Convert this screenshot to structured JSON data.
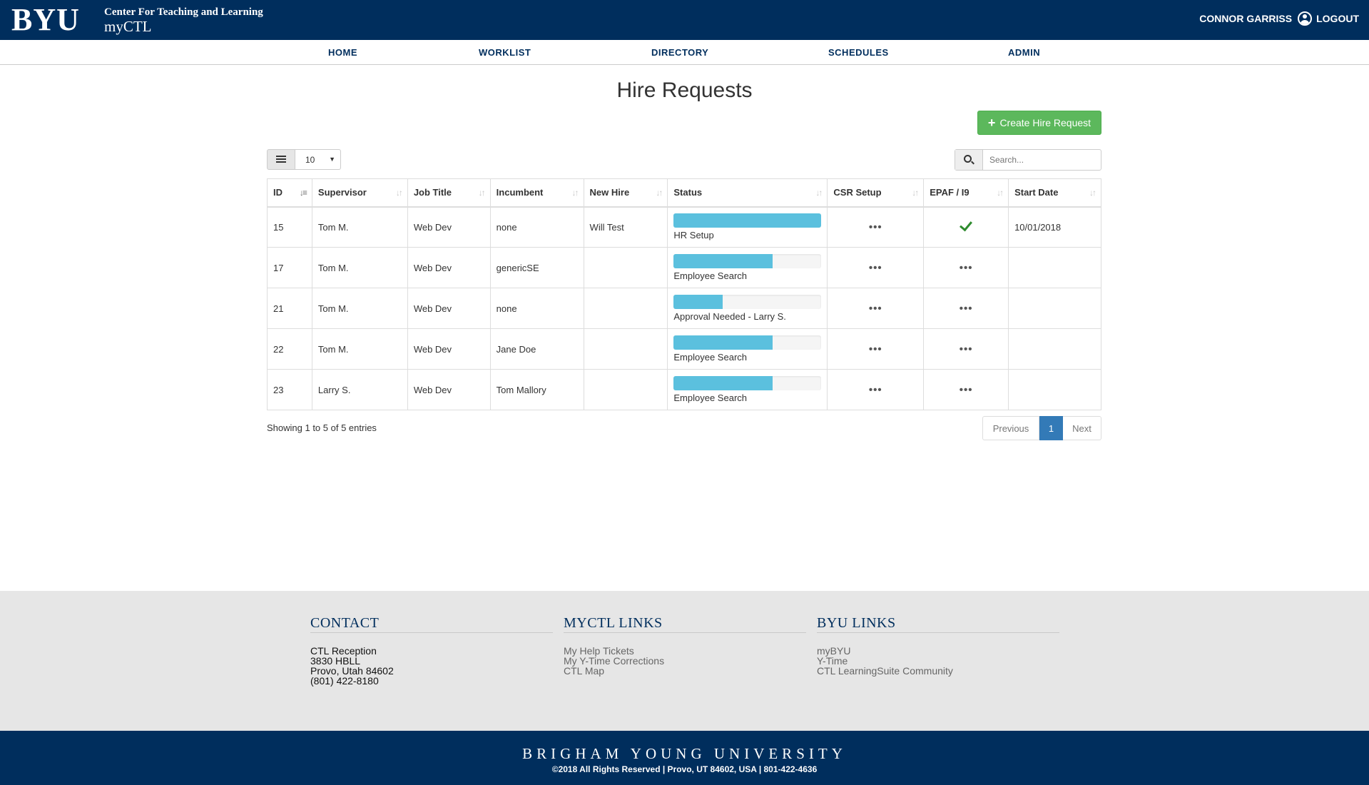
{
  "header": {
    "logo": "BYU",
    "subtitle": "Center For Teaching and Learning",
    "site_name": "myCTL",
    "user_name": "CONNOR GARRISS",
    "logout": "LOGOUT"
  },
  "nav": {
    "items": [
      {
        "label": "HOME"
      },
      {
        "label": "WORKLIST"
      },
      {
        "label": "DIRECTORY"
      },
      {
        "label": "SCHEDULES"
      },
      {
        "label": "ADMIN"
      }
    ]
  },
  "page": {
    "title": "Hire Requests",
    "create_button": "Create Hire Request",
    "page_size": "10",
    "search_placeholder": "Search..."
  },
  "table": {
    "columns": [
      "ID",
      "Supervisor",
      "Job Title",
      "Incumbent",
      "New Hire",
      "Status",
      "CSR Setup",
      "EPAF / I9",
      "Start Date"
    ],
    "rows": [
      {
        "id": "15",
        "supervisor": "Tom M.",
        "job_title": "Web Dev",
        "incumbent": "none",
        "new_hire": "Will Test",
        "status": "HR Setup",
        "progress": 1.0,
        "csr": "•••",
        "epaf": "check",
        "start_date": "10/01/2018"
      },
      {
        "id": "17",
        "supervisor": "Tom M.",
        "job_title": "Web Dev",
        "incumbent": "genericSE",
        "new_hire": "",
        "status": "Employee Search",
        "progress": 0.67,
        "csr": "•••",
        "epaf": "•••",
        "start_date": ""
      },
      {
        "id": "21",
        "supervisor": "Tom M.",
        "job_title": "Web Dev",
        "incumbent": "none",
        "new_hire": "",
        "status": "Approval Needed - Larry S.",
        "progress": 0.33,
        "csr": "•••",
        "epaf": "•••",
        "start_date": ""
      },
      {
        "id": "22",
        "supervisor": "Tom M.",
        "job_title": "Web Dev",
        "incumbent": "Jane Doe",
        "new_hire": "",
        "status": "Employee Search",
        "progress": 0.67,
        "csr": "•••",
        "epaf": "•••",
        "start_date": ""
      },
      {
        "id": "23",
        "supervisor": "Larry S.",
        "job_title": "Web Dev",
        "incumbent": "Tom Mallory",
        "new_hire": "",
        "status": "Employee Search",
        "progress": 0.67,
        "csr": "•••",
        "epaf": "•••",
        "start_date": ""
      }
    ]
  },
  "pagination": {
    "showing": "Showing 1 to 5 of 5 entries",
    "previous": "Previous",
    "current": "1",
    "next": "Next"
  },
  "footer": {
    "contact": {
      "heading": "CONTACT",
      "lines": [
        "CTL Reception",
        "3830 HBLL",
        "Provo, Utah 84602",
        "(801) 422-8180"
      ]
    },
    "myctl_links": {
      "heading": "MYCTL LINKS",
      "links": [
        "My Help Tickets",
        "My Y-Time Corrections",
        "CTL Map"
      ]
    },
    "byu_links": {
      "heading": "BYU LINKS",
      "links": [
        "myBYU",
        "Y-Time",
        "CTL LearningSuite Community"
      ]
    },
    "university": "BRIGHAM YOUNG UNIVERSITY",
    "copyright": "©2018 All Rights Reserved | Provo, UT 84602, USA | 801-422-4636"
  },
  "colors": {
    "brand_navy": "#002e5d",
    "success_green": "#5cb85c",
    "progress_blue": "#5bc0de",
    "pager_active": "#337ab7"
  }
}
